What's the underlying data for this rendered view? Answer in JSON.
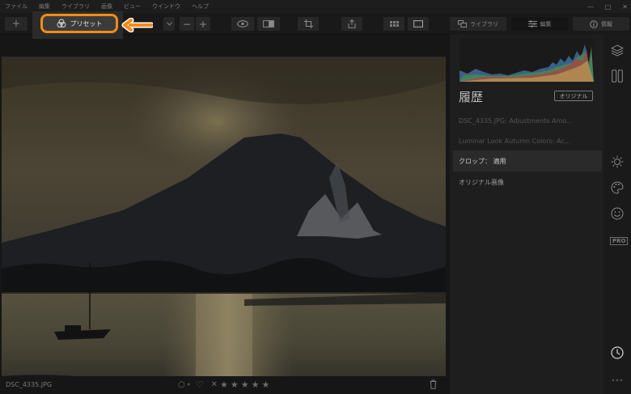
{
  "menu": {
    "items": [
      "ファイル",
      "編集",
      "ライブラリ",
      "画像",
      "ビュー",
      "ウインドウ",
      "ヘルプ"
    ],
    "window_controls": [
      "—",
      "□",
      "✕"
    ]
  },
  "toolbar": {
    "add_label": "+",
    "zoom_minus": "−",
    "zoom_plus": "+",
    "preset_label": "プリセット"
  },
  "tabs": {
    "library": "ライブラリ",
    "edit": "編集",
    "info": "情報"
  },
  "history": {
    "title": "履歴",
    "original_button": "オリジナル",
    "items": [
      "DSC_4335.JPG: Adjustments Amo...",
      "Luminar Look Autumn Colors: Ac...",
      "クロップ： 適用",
      "オリジナル画像"
    ],
    "active_index": 2
  },
  "status": {
    "filename": "DSC_4335.JPG",
    "stars": [
      "★",
      "★",
      "★",
      "★",
      "★"
    ],
    "reject": "✕",
    "heart": "♡",
    "flag": "○"
  },
  "sidebar": {
    "pro_badge": "PRO"
  },
  "colors": {
    "accent_orange": "#f28c16",
    "panel_bg": "#1e1e1e",
    "toolbar_bg": "#191919"
  }
}
